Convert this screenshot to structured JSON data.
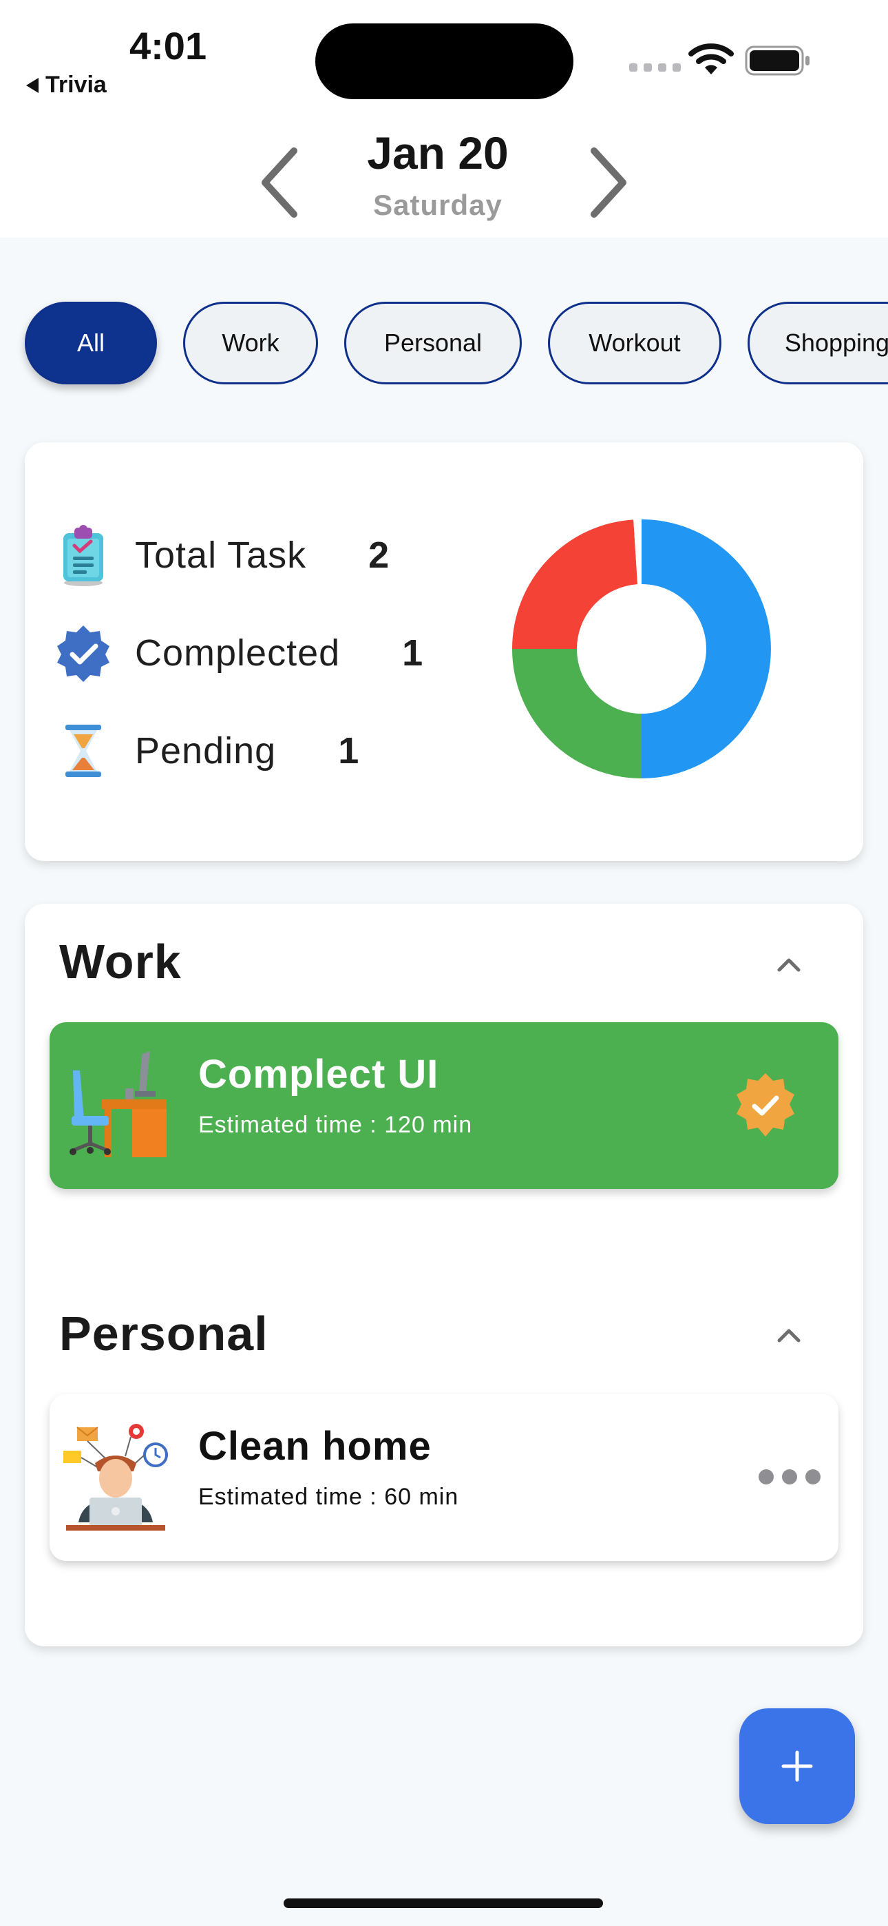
{
  "status_bar": {
    "time": "4:01",
    "back_app": "Trivia"
  },
  "date_header": {
    "date": "Jan 20",
    "weekday": "Saturday"
  },
  "filters": {
    "chips": [
      "All",
      "Work",
      "Personal",
      "Workout",
      "Shopping"
    ],
    "selected": "All"
  },
  "summary": {
    "total_label": "Total Task",
    "total_value": "2",
    "completed_label": "Complected",
    "completed_value": "1",
    "pending_label": "Pending",
    "pending_value": "1"
  },
  "donut_chart": {
    "type": "pie",
    "slices": [
      {
        "value": 50,
        "color": "#2196f3"
      },
      {
        "value": 25,
        "color": "#4caf50"
      },
      {
        "value": 24,
        "color": "#f44336"
      },
      {
        "value": 1,
        "color": "#ffffff"
      }
    ]
  },
  "sections": {
    "work": {
      "title": "Work",
      "task": {
        "name": "Complect UI",
        "meta": "Estimated time : 120 min",
        "status": "completed"
      }
    },
    "personal": {
      "title": "Personal",
      "task": {
        "name": "Clean home",
        "meta": "Estimated time : 60 min",
        "status": "pending"
      }
    }
  },
  "colors": {
    "accent": "#0e338e",
    "fab": "#3b74e8",
    "done_task": "#4caf50",
    "badge": "#f0a540"
  }
}
